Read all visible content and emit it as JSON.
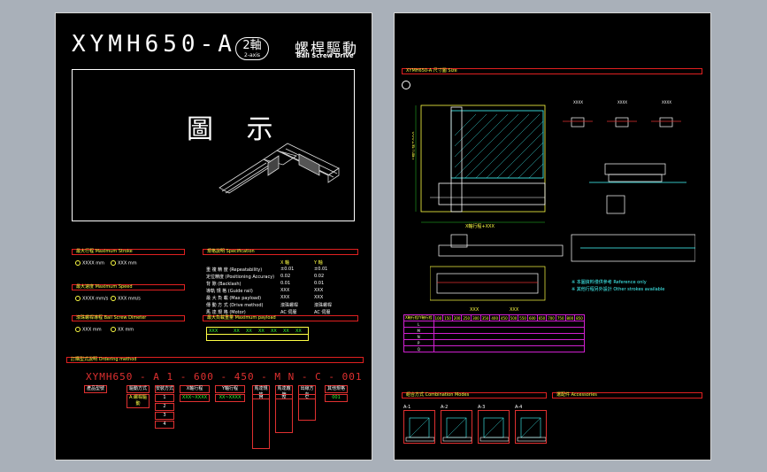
{
  "left_sheet": {
    "model": "XYMH650-A",
    "axis_badge": {
      "cn": "2軸",
      "en": "2-axis"
    },
    "drive_cn": "螺桿驅動",
    "drive_en": "Ball Screw Drive",
    "figure_label": "圖 示",
    "sections": {
      "stroke": "最大行程  Maximum Stroke",
      "spec": "規格說明  Specification",
      "speed": "最大速度  Maximum Speed",
      "screw": "滾珠螺桿導程  Ball Screw Dimeter",
      "payload": "最大負載重量  Maximum payload",
      "ordering": "訂購型式說明  Ordering method"
    },
    "stroke_options": [
      "XXXX mm",
      "XXX mm"
    ],
    "speed_options": [
      "XXXX mm/s",
      "XXX mm/s"
    ],
    "screw_options": [
      "XXX mm",
      "XX mm"
    ],
    "spec_rows": [
      "重  複  精  度 (Repeatability)",
      "定位精度 (Positioning Accuracy)",
      "背  隙 (Backlash)",
      "導軌 規 格 (Guide rail)",
      "最  大  負  載 (Max payload)",
      "傳  動  方  式 (Drive method)",
      "馬  達  規  格 (Motor)"
    ],
    "spec_cols": [
      "X 軸",
      "Y 軸"
    ],
    "spec_values": [
      [
        "±0.01",
        "±0.01"
      ],
      [
        "0.02",
        "0.02"
      ],
      [
        "0.01",
        "0.01"
      ],
      [
        "XXX",
        "XXX"
      ],
      [
        "XXX",
        "XXX"
      ],
      [
        "滾珠螺桿",
        "滾珠螺桿"
      ],
      [
        "AC 伺服",
        "AC 伺服"
      ]
    ],
    "payload_header": [
      "XXX",
      "XX",
      "XX",
      "XX",
      "XX",
      "XX",
      "XX"
    ],
    "order_code": "XYMH650 - A     1     - 600  - 450  -  M     N  - C  - 001",
    "order_labels": [
      "產品型號",
      "驅動方式",
      "安裝方式",
      "X軸行程",
      "Y軸行程",
      "馬達規格",
      "馬達廠牌",
      "出線方向",
      "其他規格"
    ],
    "order_sublabels": [
      "",
      "A:螺桿驅動",
      "1",
      "XXX~XXXX",
      "XX~XXXX",
      "M",
      "N",
      "C",
      "001"
    ],
    "order_extra": [
      "2",
      "3",
      "4"
    ]
  },
  "right_sheet": {
    "header": "XYMH650-A 尺寸圖  Size",
    "dim_labels": [
      "X軸行程+XXX",
      "Y軸行程+XXX",
      "XXX",
      "XXX"
    ],
    "grid_header": [
      "X軸行程/Y軸行程",
      "100",
      "150",
      "200",
      "250",
      "300",
      "350",
      "400",
      "450",
      "500",
      "550",
      "600",
      "650",
      "700",
      "750",
      "800",
      "850"
    ],
    "grid_rows": [
      "L",
      "M",
      "N",
      "P",
      "Q"
    ],
    "notes": [
      "※ 本圖資料僅供參考 Reference only",
      "※ 其他行程另外設計 Other strokes available"
    ],
    "section_combo": "組合方式  Combination Modes",
    "section_acc": "選配件  Accessories",
    "thumb_labels": [
      "A-1",
      "A-2",
      "A-3",
      "A-4"
    ]
  }
}
